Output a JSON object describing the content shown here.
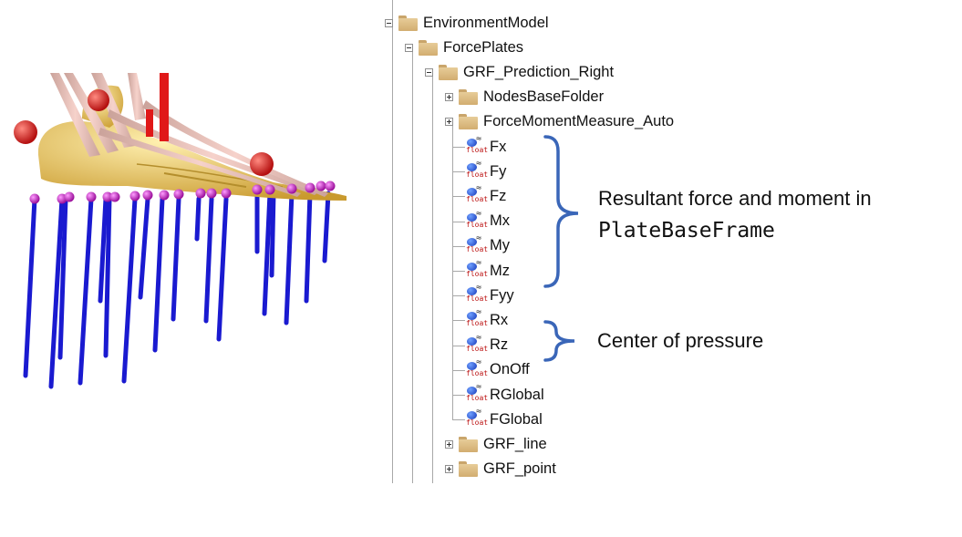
{
  "tree": {
    "nodes": [
      {
        "label": "EnvironmentModel",
        "kind": "folder",
        "expander": "minus"
      },
      {
        "label": "ForcePlates",
        "kind": "folder",
        "expander": "minus"
      },
      {
        "label": "GRF_Prediction_Right",
        "kind": "folder",
        "expander": "minus"
      },
      {
        "label": "NodesBaseFolder",
        "kind": "folder",
        "expander": "plus"
      },
      {
        "label": "ForceMomentMeasure_Auto",
        "kind": "folder",
        "expander": "plus"
      },
      {
        "label": "Fx",
        "kind": "float"
      },
      {
        "label": "Fy",
        "kind": "float"
      },
      {
        "label": "Fz",
        "kind": "float"
      },
      {
        "label": "Mx",
        "kind": "float"
      },
      {
        "label": "My",
        "kind": "float"
      },
      {
        "label": "Mz",
        "kind": "float"
      },
      {
        "label": "Fyy",
        "kind": "float"
      },
      {
        "label": "Rx",
        "kind": "float"
      },
      {
        "label": "Rz",
        "kind": "float"
      },
      {
        "label": "OnOff",
        "kind": "float"
      },
      {
        "label": "RGlobal",
        "kind": "float"
      },
      {
        "label": "FGlobal",
        "kind": "float"
      },
      {
        "label": "GRF_line",
        "kind": "folder",
        "expander": "plus"
      },
      {
        "label": "GRF_point",
        "kind": "folder",
        "expander": "plus"
      }
    ],
    "float_icon_text": "float",
    "float_icon_symbol": "≈"
  },
  "annotations": {
    "resultant_line1": "Resultant force and moment in",
    "resultant_line2": "PlateBaseFrame",
    "center_of_pressure": "Center of pressure",
    "brace_color": "#3a66b8"
  },
  "viewport": {
    "description_icons": {
      "marker_color": "#d62020",
      "bone_color": "#e3c15a",
      "muscle_color": "#e8b8b0",
      "force_line_color": "#1414c8",
      "contact_node_color": "#cc22cc"
    }
  }
}
